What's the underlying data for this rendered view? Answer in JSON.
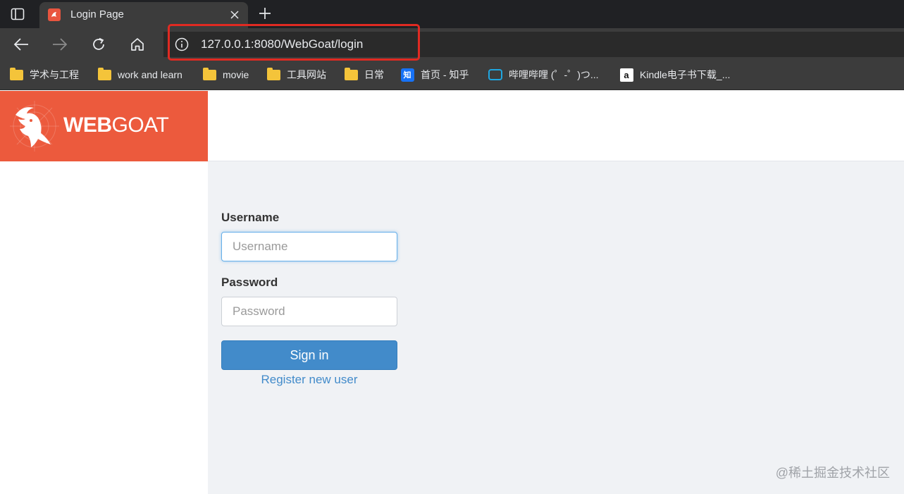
{
  "browser": {
    "tab": {
      "title": "Login Page"
    },
    "address": {
      "url": "127.0.0.1:8080/WebGoat/login"
    },
    "bookmarks": [
      {
        "label": "学术与工程",
        "icon": "folder-icon"
      },
      {
        "label": "work and learn",
        "icon": "folder-icon"
      },
      {
        "label": "movie",
        "icon": "folder-icon"
      },
      {
        "label": "工具网站",
        "icon": "folder-icon"
      },
      {
        "label": "日常",
        "icon": "folder-icon"
      },
      {
        "label": "首页 - 知乎",
        "icon": "zhihu-icon",
        "icon_text": "知"
      },
      {
        "label": "哔哩哔哩 (゜-゜)つ...",
        "icon": "bilibili-icon"
      },
      {
        "label": "Kindle电子书下载_...",
        "icon": "amazon-icon",
        "icon_text": "a"
      }
    ]
  },
  "header": {
    "brand_bold": "WEB",
    "brand_light": "GOAT",
    "brand_color": "#ec5a3d"
  },
  "login": {
    "username_label": "Username",
    "username_placeholder": "Username",
    "password_label": "Password",
    "password_placeholder": "Password",
    "signin_label": "Sign in",
    "register_label": "Register new user",
    "button_color": "#428bca"
  },
  "watermark": "@稀土掘金技术社区"
}
